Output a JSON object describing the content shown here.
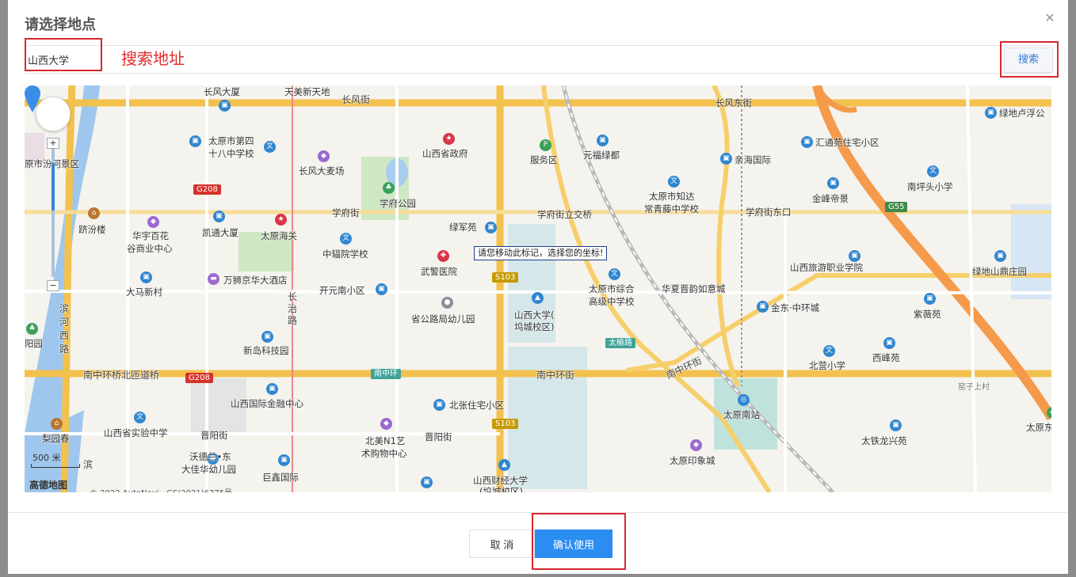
{
  "dialog": {
    "title": "请选择地点",
    "close_glyph": "✕",
    "search_value": "山西大学",
    "hint": "搜索地址",
    "search_button": "搜索",
    "cancel_button": "取 消",
    "confirm_button": "确认使用"
  },
  "map": {
    "tooltip": "请您移动此标记，选择您的坐标!",
    "scale_label": "500 米",
    "logo_text": "高德地图",
    "copyright": "© 2022 AutoNavi - GS(2021)6375号",
    "zoom_in": "+",
    "zoom_out": "−",
    "labels": [
      {
        "t": "长风大厦"
      },
      {
        "t": "天美新天地"
      },
      {
        "t": "长风街"
      },
      {
        "t": "长风东街"
      },
      {
        "t": "绿地卢浮公"
      },
      {
        "t": "太原市第四"
      },
      {
        "t": "十八中学校"
      },
      {
        "t": "山西省政府"
      },
      {
        "t": "服务区"
      },
      {
        "t": "元福绿都"
      },
      {
        "t": "汇通苑住宅小区"
      },
      {
        "t": "原市汾河景区"
      },
      {
        "t": "长风大麦场"
      },
      {
        "t": "亲海国际"
      },
      {
        "t": "南坪头小学"
      },
      {
        "t": "学府公园"
      },
      {
        "t": "太原市知达"
      },
      {
        "t": "常青藤中学校"
      },
      {
        "t": "金峰帝景"
      },
      {
        "t": "学府街"
      },
      {
        "t": "学府街立交桥"
      },
      {
        "t": "学府街东口"
      },
      {
        "t": "跻汾楼"
      },
      {
        "t": "华宇百花"
      },
      {
        "t": "谷商业中心"
      },
      {
        "t": "凯通大厦"
      },
      {
        "t": "太原海关"
      },
      {
        "t": "绿军苑"
      },
      {
        "t": "中辐院学校"
      },
      {
        "t": "武警医院"
      },
      {
        "t": "山西旅游职业学院"
      },
      {
        "t": "绿地山鼎庄园"
      },
      {
        "t": "万狮京华大酒店"
      },
      {
        "t": "太原市综合"
      },
      {
        "t": "高级中学校"
      },
      {
        "t": "华夏晋韵如意城"
      },
      {
        "t": "大马新村"
      },
      {
        "t": "开元南小区"
      },
      {
        "t": "省公路局幼儿园"
      },
      {
        "t": "山西大学("
      },
      {
        "t": "坞城校区)"
      },
      {
        "t": "金东·中环城"
      },
      {
        "t": "紫薇苑"
      },
      {
        "t": "滨"
      },
      {
        "t": "河"
      },
      {
        "t": "西"
      },
      {
        "t": "路"
      },
      {
        "t": "阳园"
      },
      {
        "t": "新岛科技园"
      },
      {
        "t": "西峰苑"
      },
      {
        "t": "北营小学"
      },
      {
        "t": "南中环桥北匝道桥"
      },
      {
        "t": "南中环街"
      },
      {
        "t": "南中环街"
      },
      {
        "t": "窑子上村"
      },
      {
        "t": "山西国际金融中心"
      },
      {
        "t": "北张住宅小区"
      },
      {
        "t": "太原南站"
      },
      {
        "t": "太原东"
      },
      {
        "t": "梨园春"
      },
      {
        "t": "山西省实验中学"
      },
      {
        "t": "晋阳街"
      },
      {
        "t": "北美N1艺"
      },
      {
        "t": "术购物中心"
      },
      {
        "t": "晋阳街"
      },
      {
        "t": "太铁龙兴苑"
      },
      {
        "t": "沃德兰•东"
      },
      {
        "t": "大佳华幼儿园"
      },
      {
        "t": "太原印象城"
      },
      {
        "t": "巨鑫国际"
      },
      {
        "t": "山西财经大学"
      },
      {
        "t": "(坞城校区)"
      },
      {
        "t": "长"
      },
      {
        "t": "治"
      },
      {
        "t": "路"
      },
      {
        "t": "滨"
      }
    ],
    "badges": [
      {
        "t": "G208"
      },
      {
        "t": "G208"
      },
      {
        "t": "G55"
      },
      {
        "t": "S103"
      },
      {
        "t": "S103"
      },
      {
        "t": "南中环"
      },
      {
        "t": "太榆路"
      }
    ]
  }
}
